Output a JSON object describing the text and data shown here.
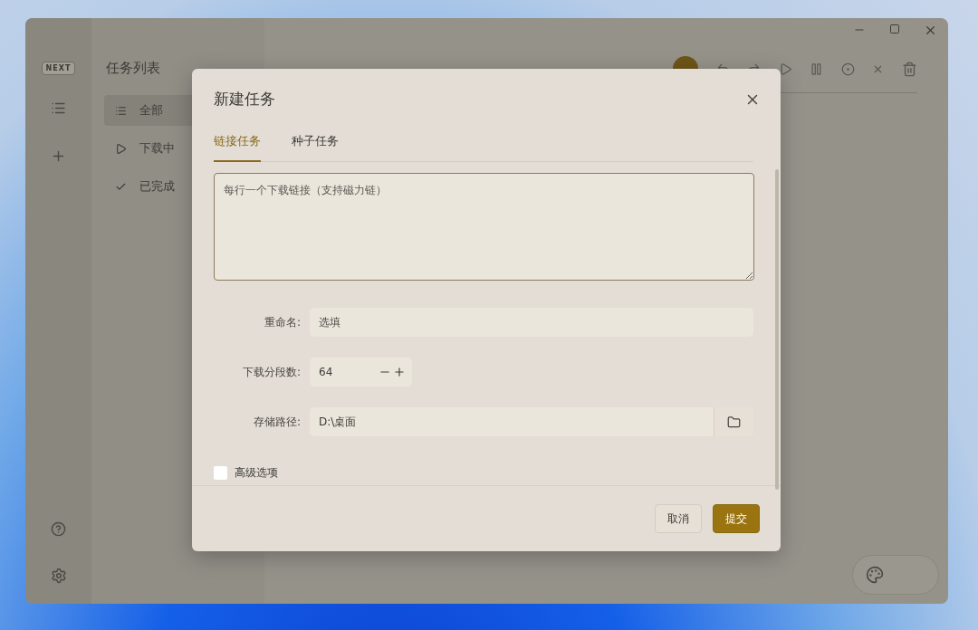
{
  "app": {
    "logo": "NEXT"
  },
  "sidebar": {
    "title": "任务列表",
    "items": [
      {
        "kind": "all",
        "label": "全部",
        "selected": true
      },
      {
        "kind": "active",
        "label": "下载中",
        "selected": false
      },
      {
        "kind": "done",
        "label": "已完成",
        "selected": false
      }
    ]
  },
  "dialog": {
    "title": "新建任务",
    "tabs": [
      {
        "label": "链接任务",
        "selected": true
      },
      {
        "label": "种子任务",
        "selected": false
      }
    ],
    "links": {
      "placeholder": "每行一个下载链接（支持磁力链）"
    },
    "fields": [
      {
        "kind": "text",
        "label": "重命名:",
        "placeholder": "选填"
      },
      {
        "kind": "stepper",
        "label": "下载分段数:",
        "value": "64"
      },
      {
        "kind": "path",
        "label": "存储路径:",
        "value": "D:\\桌面"
      }
    ],
    "advanced": {
      "label": "高级选项",
      "checked": false
    },
    "buttons": [
      {
        "kind": "secondary",
        "label": "取消"
      },
      {
        "kind": "primary",
        "label": "提交"
      }
    ]
  }
}
